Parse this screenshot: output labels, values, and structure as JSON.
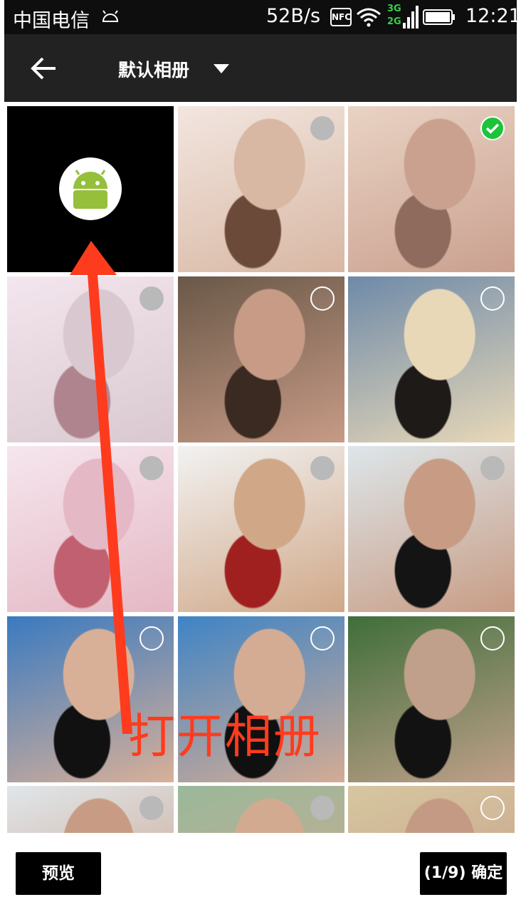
{
  "status_bar": {
    "carrier": "中国电信",
    "net_speed": "52B/s",
    "nfc": "NFC",
    "net_top": "3G",
    "net_bottom": "2G",
    "time": "12:21"
  },
  "title_bar": {
    "back_icon": "back-arrow-icon",
    "album_name": "默认相册",
    "dropdown_icon": "caret-down-icon"
  },
  "grid": {
    "camera_tile_icon": "android-icon",
    "photos": [
      {
        "state": "unselected-filled",
        "palette": [
          "#f2e6e0",
          "#d8b7a3",
          "#6b4a3a"
        ]
      },
      {
        "state": "selected",
        "palette": [
          "#e9d3c4",
          "#caa08f",
          "#8e6b5d"
        ]
      },
      {
        "state": "unselected-filled",
        "palette": [
          "#f4e6ee",
          "#d9c8d0",
          "#b0848e"
        ]
      },
      {
        "state": "unselected-outline",
        "palette": [
          "#6a5848",
          "#c79b86",
          "#3a2a22"
        ]
      },
      {
        "state": "unselected-outline",
        "palette": [
          "#6e8aa8",
          "#e8d8b8",
          "#1e1a18"
        ]
      },
      {
        "state": "unselected-filled",
        "palette": [
          "#f6e6ee",
          "#e4b8c4",
          "#c06070"
        ]
      },
      {
        "state": "unselected-filled",
        "palette": [
          "#f2f2f2",
          "#d0a888",
          "#a02020"
        ]
      },
      {
        "state": "unselected-filled",
        "palette": [
          "#dde6ea",
          "#c89c84",
          "#141414"
        ]
      },
      {
        "state": "unselected-outline",
        "palette": [
          "#3a7ac0",
          "#d8b098",
          "#111111"
        ]
      },
      {
        "state": "unselected-outline",
        "palette": [
          "#3e84c6",
          "#d4ac94",
          "#101010"
        ]
      },
      {
        "state": "unselected-outline",
        "palette": [
          "#3f6e3a",
          "#c0a08a",
          "#121212"
        ]
      },
      {
        "state": "unselected-filled",
        "palette": [
          "#e0e6ea",
          "#c89c84",
          "#402a20"
        ]
      },
      {
        "state": "unselected-filled",
        "palette": [
          "#9ab89a",
          "#d2aa90",
          "#2a1e18"
        ]
      },
      {
        "state": "unselected-outline",
        "palette": [
          "#d6c7a0",
          "#c49a84",
          "#3a2a20"
        ]
      }
    ]
  },
  "bottom_bar": {
    "preview_label": "预览",
    "confirm_label": "(1/9) 确定"
  },
  "annotation": {
    "label": "打开相册",
    "color": "#ff3b1e"
  }
}
